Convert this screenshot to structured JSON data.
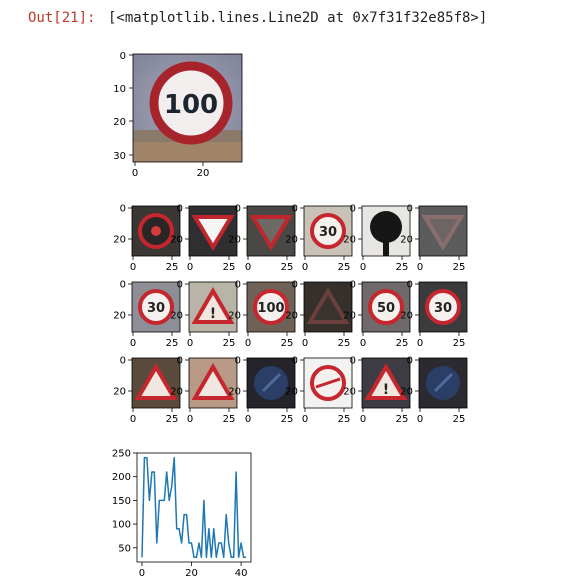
{
  "cell": {
    "prompt": "Out[21]:",
    "output": "[<matplotlib.lines.Line2D at 0x7f31f32e85f8>]"
  },
  "big_image": {
    "y_ticks": [
      "0",
      "10",
      "20",
      "30"
    ],
    "x_ticks": [
      "0",
      "20"
    ],
    "sign_text": "100"
  },
  "grid_ticks": {
    "y": [
      "0",
      "20"
    ],
    "x": [
      "0",
      "25"
    ]
  },
  "grid_images": [
    {
      "kind": "circle-slash",
      "bg": "#3a3634"
    },
    {
      "kind": "yield",
      "bg": "#2f2f31"
    },
    {
      "kind": "yield-dark",
      "bg": "#4a4845"
    },
    {
      "kind": "circle-text",
      "text": "30",
      "bg": "#c9c2b8"
    },
    {
      "kind": "blob",
      "bg": "#e8e6e2"
    },
    {
      "kind": "yield-faint",
      "bg": "#5c5c5c"
    },
    {
      "kind": "circle-text",
      "text": "30",
      "bg": "#8e8f96"
    },
    {
      "kind": "warning",
      "text": "!",
      "bg": "#b9b4a8"
    },
    {
      "kind": "circle-text",
      "text": "100",
      "bg": "#6d6158"
    },
    {
      "kind": "triangle-faint",
      "bg": "#36302c"
    },
    {
      "kind": "circle-text",
      "text": "50",
      "bg": "#6f6a69"
    },
    {
      "kind": "circle-text",
      "text": "30",
      "bg": "#3b3b3d"
    },
    {
      "kind": "warning-tree",
      "bg": "#594a3b"
    },
    {
      "kind": "warning-light",
      "bg": "#b89a86"
    },
    {
      "kind": "arrow-dark",
      "bg": "#24242a"
    },
    {
      "kind": "no-entry",
      "bg": "#f2f2f2"
    },
    {
      "kind": "warning",
      "text": "!",
      "bg": "#3c3c42"
    },
    {
      "kind": "arrow-dark",
      "bg": "#2a2a30"
    }
  ],
  "chart_data": {
    "type": "line",
    "color": "#1f77b4",
    "x": [
      0,
      1,
      2,
      3,
      4,
      5,
      6,
      7,
      8,
      9,
      10,
      11,
      12,
      13,
      14,
      15,
      16,
      17,
      18,
      19,
      20,
      21,
      22,
      23,
      24,
      25,
      26,
      27,
      28,
      29,
      30,
      31,
      32,
      33,
      34,
      35,
      36,
      37,
      38,
      39,
      40,
      41,
      42
    ],
    "y": [
      30,
      240,
      240,
      150,
      210,
      210,
      60,
      150,
      150,
      150,
      210,
      150,
      180,
      240,
      90,
      90,
      60,
      120,
      120,
      60,
      60,
      30,
      30,
      60,
      30,
      150,
      30,
      90,
      30,
      90,
      30,
      60,
      60,
      30,
      120,
      60,
      30,
      30,
      210,
      30,
      60,
      30,
      30
    ],
    "xlim": [
      -2,
      44
    ],
    "ylim": [
      20,
      250
    ],
    "x_ticks": [
      0,
      20,
      40
    ],
    "y_ticks": [
      50,
      100,
      150,
      200,
      250
    ],
    "x_tick_labels": [
      "0",
      "20",
      "40"
    ],
    "y_tick_labels": [
      "50",
      "100",
      "150",
      "200",
      "250"
    ]
  }
}
